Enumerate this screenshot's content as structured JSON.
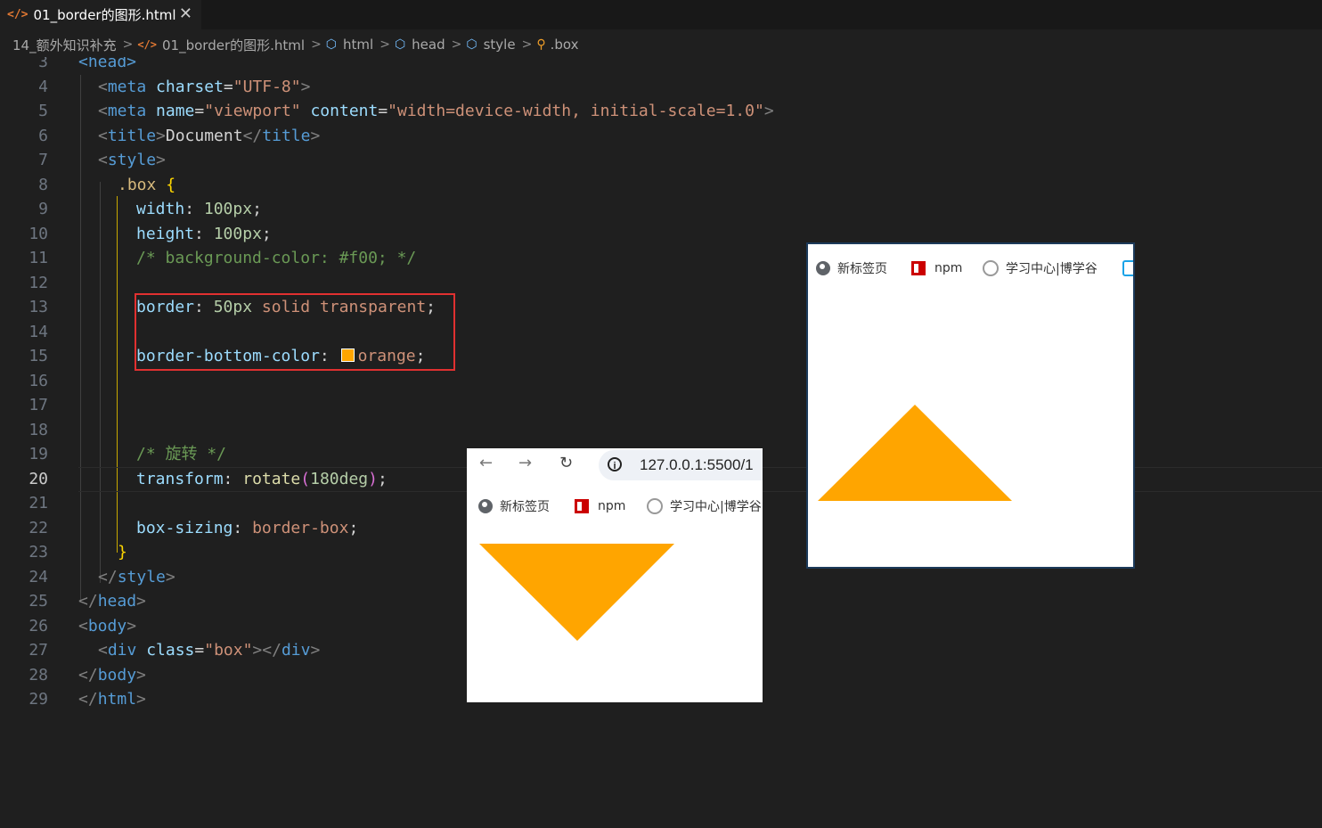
{
  "tab": {
    "icon": "html-file-icon",
    "title": "01_border的图形.html",
    "close": "✕"
  },
  "breadcrumb": {
    "folder": "14_额外知识补充",
    "file": "01_border的图形.html",
    "items": [
      "html",
      "head",
      "style"
    ],
    "symbol": ".box"
  },
  "editor": {
    "active_line": "20",
    "lines": [
      {
        "n": "3",
        "parts": [
          [
            "tag",
            "<head>"
          ]
        ]
      },
      {
        "n": "4",
        "parts": [
          [
            "pun",
            "<"
          ],
          [
            "tag",
            "meta"
          ],
          [
            "txt",
            " "
          ],
          [
            "attr",
            "charset"
          ],
          [
            "txt",
            "="
          ],
          [
            "str",
            "\"UTF-8\""
          ],
          [
            "pun",
            ">"
          ]
        ]
      },
      {
        "n": "5",
        "parts": [
          [
            "pun",
            "<"
          ],
          [
            "tag",
            "meta"
          ],
          [
            "txt",
            " "
          ],
          [
            "attr",
            "name"
          ],
          [
            "txt",
            "="
          ],
          [
            "str",
            "\"viewport\""
          ],
          [
            "txt",
            " "
          ],
          [
            "attr",
            "content"
          ],
          [
            "txt",
            "="
          ],
          [
            "str",
            "\"width=device-width, initial-scale=1.0\""
          ],
          [
            "pun",
            ">"
          ]
        ]
      },
      {
        "n": "6",
        "parts": [
          [
            "pun",
            "<"
          ],
          [
            "tag",
            "title"
          ],
          [
            "pun",
            ">"
          ],
          [
            "txt",
            "Document"
          ],
          [
            "pun",
            "</"
          ],
          [
            "tag",
            "title"
          ],
          [
            "pun",
            ">"
          ]
        ]
      },
      {
        "n": "7",
        "parts": [
          [
            "pun",
            "<"
          ],
          [
            "tag",
            "style"
          ],
          [
            "pun",
            ">"
          ]
        ]
      },
      {
        "n": "8",
        "parts": [
          [
            "sel",
            ".box"
          ],
          [
            "txt",
            " "
          ],
          [
            "brace",
            "{"
          ]
        ]
      },
      {
        "n": "9",
        "parts": [
          [
            "prop",
            "width"
          ],
          [
            "txt",
            ": "
          ],
          [
            "num",
            "100px"
          ],
          [
            "txt",
            ";"
          ]
        ]
      },
      {
        "n": "10",
        "parts": [
          [
            "prop",
            "height"
          ],
          [
            "txt",
            ": "
          ],
          [
            "num",
            "100px"
          ],
          [
            "txt",
            ";"
          ]
        ]
      },
      {
        "n": "11",
        "parts": [
          [
            "cmt",
            "/* background-color: #f00; */"
          ]
        ]
      },
      {
        "n": "12",
        "parts": []
      },
      {
        "n": "13",
        "parts": [
          [
            "prop",
            "border"
          ],
          [
            "txt",
            ": "
          ],
          [
            "num",
            "50px"
          ],
          [
            "txt",
            " "
          ],
          [
            "val",
            "solid"
          ],
          [
            "txt",
            " "
          ],
          [
            "val",
            "transparent"
          ],
          [
            "txt",
            ";"
          ]
        ]
      },
      {
        "n": "14",
        "parts": []
      },
      {
        "n": "15",
        "parts": [
          [
            "prop",
            "border-bottom-color"
          ],
          [
            "txt",
            ": "
          ],
          [
            "swatch",
            ""
          ],
          [
            "val",
            "orange"
          ],
          [
            "txt",
            ";"
          ]
        ]
      },
      {
        "n": "16",
        "parts": []
      },
      {
        "n": "17",
        "parts": []
      },
      {
        "n": "18",
        "parts": []
      },
      {
        "n": "19",
        "parts": [
          [
            "cmt",
            "/* 旋转 */"
          ]
        ]
      },
      {
        "n": "20",
        "parts": [
          [
            "prop",
            "transform"
          ],
          [
            "txt",
            ": "
          ],
          [
            "fn",
            "rotate"
          ],
          [
            "par",
            "("
          ],
          [
            "num",
            "180deg"
          ],
          [
            "par",
            ")"
          ],
          [
            "txt",
            ";"
          ]
        ]
      },
      {
        "n": "21",
        "parts": []
      },
      {
        "n": "22",
        "parts": [
          [
            "prop",
            "box-sizing"
          ],
          [
            "txt",
            ": "
          ],
          [
            "val",
            "border-box"
          ],
          [
            "txt",
            ";"
          ]
        ]
      },
      {
        "n": "23",
        "parts": [
          [
            "brace",
            "}"
          ]
        ]
      },
      {
        "n": "24",
        "parts": [
          [
            "pun",
            "</"
          ],
          [
            "tag",
            "style"
          ],
          [
            "pun",
            ">"
          ]
        ]
      },
      {
        "n": "25",
        "parts": [
          [
            "pun",
            "</"
          ],
          [
            "tag",
            "head"
          ],
          [
            "pun",
            ">"
          ]
        ]
      },
      {
        "n": "26",
        "parts": [
          [
            "pun",
            "<"
          ],
          [
            "tag",
            "body"
          ],
          [
            "pun",
            ">"
          ]
        ]
      },
      {
        "n": "27",
        "parts": [
          [
            "pun",
            "<"
          ],
          [
            "tag",
            "div"
          ],
          [
            "txt",
            " "
          ],
          [
            "attr",
            "class"
          ],
          [
            "txt",
            "="
          ],
          [
            "str",
            "\"box\""
          ],
          [
            "pun",
            "></"
          ],
          [
            "tag",
            "div"
          ],
          [
            "pun",
            ">"
          ]
        ]
      },
      {
        "n": "28",
        "parts": [
          [
            "pun",
            "</"
          ],
          [
            "tag",
            "body"
          ],
          [
            "pun",
            ">"
          ]
        ]
      },
      {
        "n": "29",
        "parts": [
          [
            "pun",
            "</"
          ],
          [
            "tag",
            "html"
          ],
          [
            "pun",
            ">"
          ]
        ]
      }
    ]
  },
  "browser_small": {
    "url": "127.0.0.1:5500/1",
    "bookmarks": [
      {
        "icon": "globe-icon",
        "label": "新标签页"
      },
      {
        "icon": "npm-icon",
        "label": "npm"
      },
      {
        "icon": "spiral-icon",
        "label": "学习中心|博学谷"
      }
    ],
    "triangle": {
      "direction": "down",
      "color": "#ffa500"
    }
  },
  "browser_large": {
    "bookmarks": [
      {
        "icon": "globe-icon",
        "label": "新标签页"
      },
      {
        "icon": "npm-icon",
        "label": "npm"
      },
      {
        "icon": "spiral-icon",
        "label": "学习中心|博学谷"
      },
      {
        "icon": "bilibili-tv-icon",
        "label": ""
      }
    ],
    "triangle": {
      "direction": "up",
      "color": "#ffa500"
    }
  },
  "colors": {
    "editor_bg": "#1f1f1f",
    "highlight_box": "#e03030",
    "orange": "#ffa500"
  }
}
